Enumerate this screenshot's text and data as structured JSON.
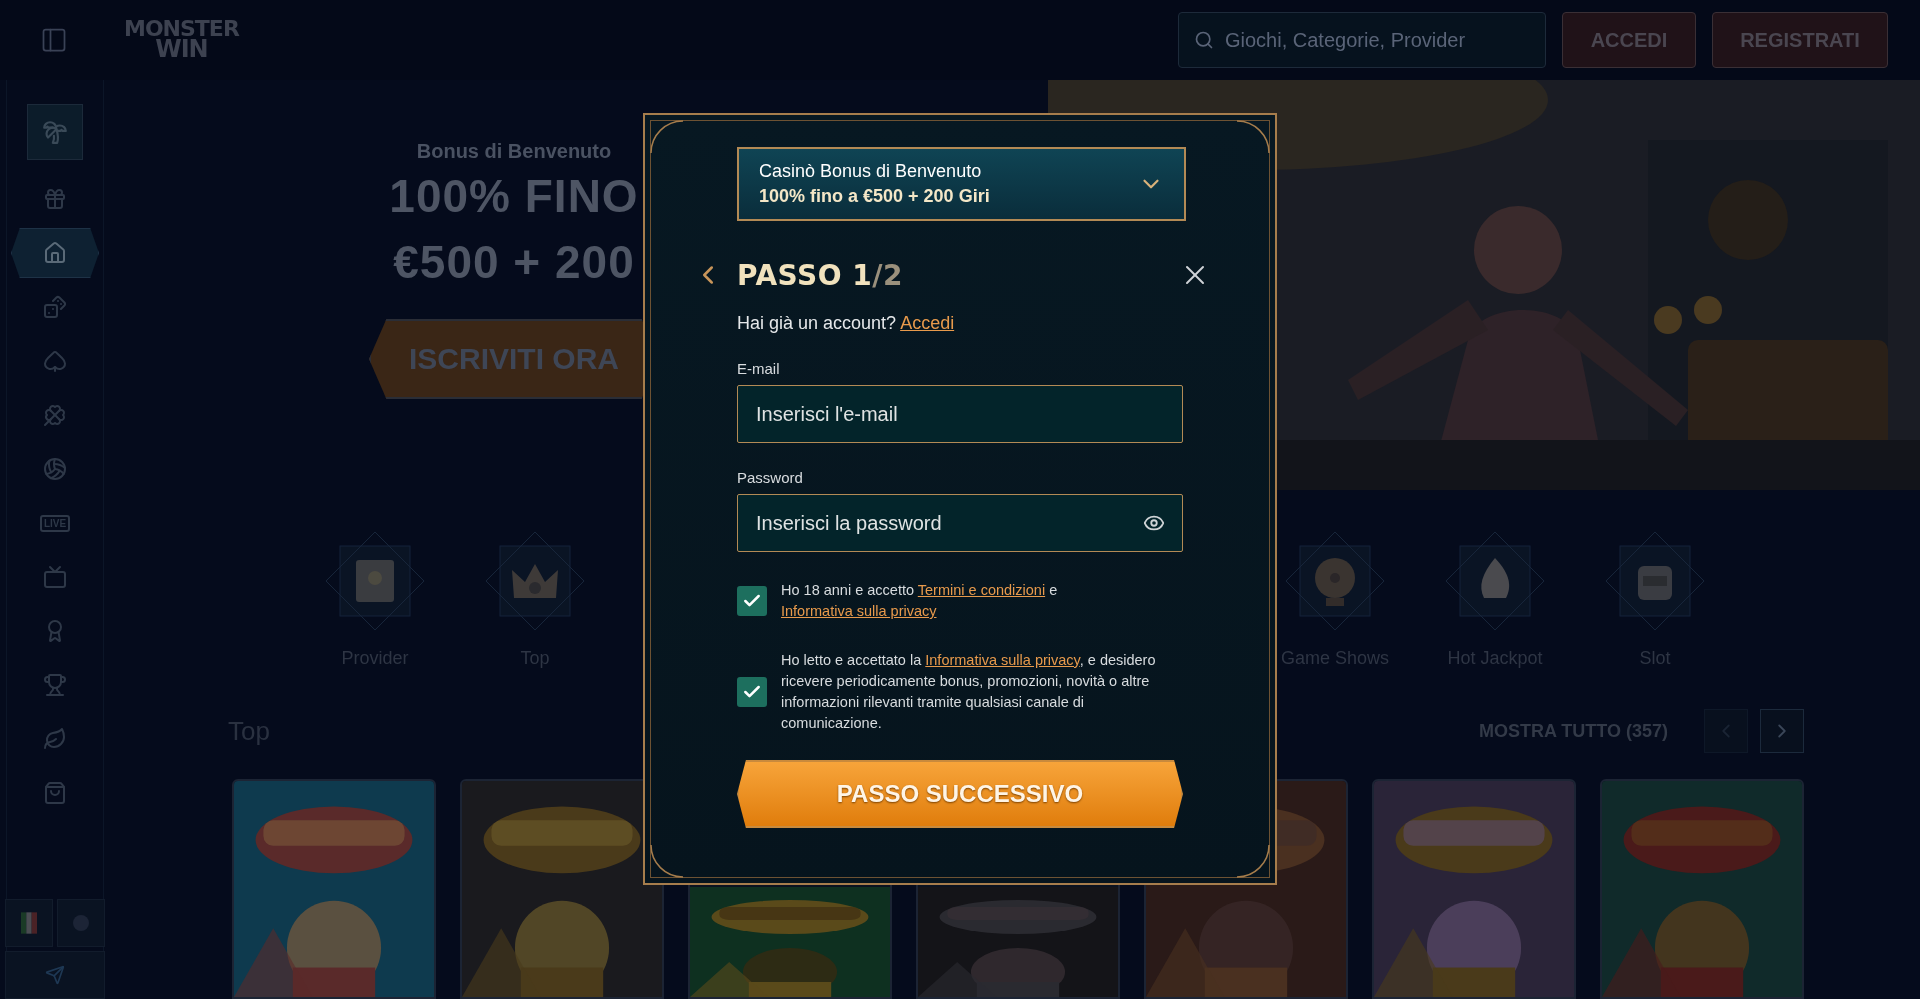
{
  "header": {
    "logo_lines": [
      "MONSTER",
      "WIN"
    ],
    "search": {
      "placeholder": "Giochi, Categorie, Provider"
    },
    "buttons": [
      {
        "label": "ACCEDI",
        "kind": "login"
      },
      {
        "label": "REGISTRATI",
        "kind": "register"
      }
    ]
  },
  "sidebar": {
    "items": [
      {
        "selected": false
      },
      {
        "selected": true
      },
      {
        "selected": false
      },
      {
        "selected": false
      },
      {
        "selected": false
      },
      {
        "selected": false
      },
      {
        "label": "LIVE",
        "selected": false
      },
      {
        "selected": false
      },
      {
        "selected": false
      },
      {
        "selected": false
      },
      {
        "selected": false
      },
      {
        "selected": false
      }
    ]
  },
  "hero": {
    "subtitle": "Bonus di Benvenuto",
    "headline": [
      "100% FINO",
      "€500 + 200"
    ],
    "cta": "ISCRIVITI ORA",
    "image": {
      "kind": "picture"
    }
  },
  "categories": [
    {
      "label": "Provider"
    },
    {
      "label": "Top"
    },
    {
      "label": "Game Shows"
    },
    {
      "label": "Hot Jackpot"
    },
    {
      "label": "Slot"
    }
  ],
  "top_section": {
    "title": "Top",
    "show_all": "MOSTRA TUTTO (357)",
    "arrows": [
      {
        "disabled": true
      },
      {
        "disabled": false
      }
    ],
    "games": [
      {
        "kind": "picture"
      },
      {
        "kind": "picture"
      },
      {
        "kind": "picture"
      },
      {
        "kind": "picture"
      },
      {
        "kind": "picture"
      },
      {
        "kind": "picture"
      },
      {
        "kind": "picture"
      }
    ]
  },
  "modal": {
    "bonus_select": {
      "line1": "Casinò Bonus di Benvenuto",
      "line2": "100% fino a €500 + 200 Giri"
    },
    "title": "PASSO 1",
    "title_suffix": "/2",
    "account_prompt": "Hai già un account?",
    "account_link": "Accedi",
    "fields": [
      {
        "kind": "email",
        "label": "E-mail",
        "placeholder": "Inserisci l'e-mail"
      },
      {
        "kind": "password",
        "label": "Password",
        "placeholder": "Inserisci la password"
      }
    ],
    "consents": [
      {
        "checked": true,
        "parts": [
          {
            "kind": "text",
            "text": "Ho 18 anni e accetto "
          },
          {
            "kind": "link",
            "text": "Termini e condizioni"
          },
          {
            "kind": "text",
            "text": " e "
          },
          {
            "kind": "link",
            "text": "Informativa sulla privacy"
          }
        ]
      },
      {
        "checked": true,
        "parts": [
          {
            "kind": "text",
            "text": "Ho letto e accettato la "
          },
          {
            "kind": "link",
            "text": "Informativa sulla privacy"
          },
          {
            "kind": "text",
            "text": ", e desidero ricevere periodicamente bonus, promozioni, novità o altre informazioni rilevanti tramite qualsiasi canale di comunicazione."
          }
        ]
      }
    ],
    "submit": "PASSO SUCCESSIVO"
  }
}
